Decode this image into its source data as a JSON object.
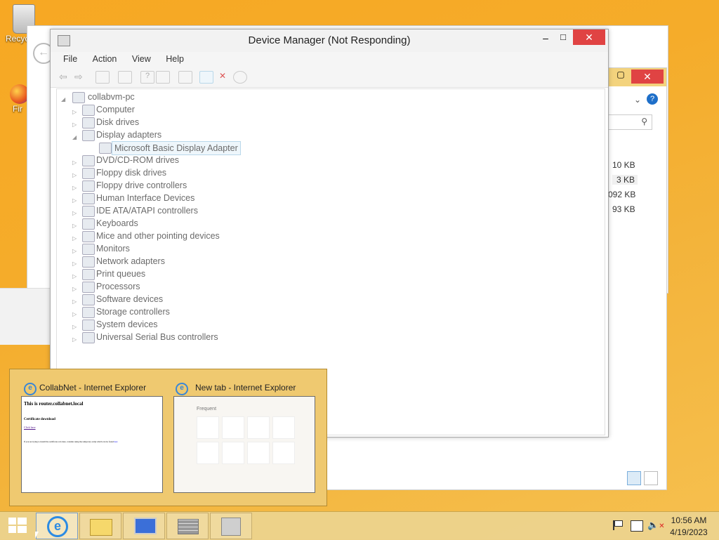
{
  "desktop": {
    "recycle_label": "Recyc",
    "firefox_label": "Fir"
  },
  "device_manager": {
    "title": "Device Manager (Not Responding)",
    "menu": [
      "File",
      "Action",
      "View",
      "Help"
    ],
    "root": "collabvm-pc",
    "items": [
      {
        "label": "Computer",
        "expanded": false
      },
      {
        "label": "Disk drives",
        "expanded": false
      },
      {
        "label": "Display adapters",
        "expanded": true
      },
      {
        "label": "Microsoft Basic Display Adapter",
        "child": true
      },
      {
        "label": "DVD/CD-ROM drives",
        "expanded": false
      },
      {
        "label": "Floppy disk drives",
        "expanded": false
      },
      {
        "label": "Floppy drive controllers",
        "expanded": false
      },
      {
        "label": "Human Interface Devices",
        "expanded": false
      },
      {
        "label": "IDE ATA/ATAPI controllers",
        "expanded": false
      },
      {
        "label": "Keyboards",
        "expanded": false
      },
      {
        "label": "Mice and other pointing devices",
        "expanded": false
      },
      {
        "label": "Monitors",
        "expanded": false
      },
      {
        "label": "Network adapters",
        "expanded": false
      },
      {
        "label": "Print queues",
        "expanded": false
      },
      {
        "label": "Processors",
        "expanded": false
      },
      {
        "label": "Software devices",
        "expanded": false
      },
      {
        "label": "Storage controllers",
        "expanded": false
      },
      {
        "label": "System devices",
        "expanded": false
      },
      {
        "label": "Universal Serial Bus controllers",
        "expanded": false
      }
    ]
  },
  "explorer": {
    "sizes": [
      "10 KB",
      "3 KB",
      "092 KB",
      "93 KB"
    ]
  },
  "thumbnails": [
    {
      "title": "CollabNet - Internet Explorer",
      "heading": "This is router.collabnet.local",
      "sub": "Certificate download",
      "link": "Click here",
      "body": "If you are trying to install the certificate on Linux, consider using the temporary script which can be found",
      "body_link": "here"
    },
    {
      "title": "New tab - Internet Explorer",
      "frequent": "Frequent"
    }
  ],
  "taskbar": {
    "time": "10:56 AM",
    "date": "4/19/2023"
  },
  "colors": {
    "desktop": "#f7a823",
    "close_red": "#e04343",
    "taskbar": "#ebd48f"
  }
}
